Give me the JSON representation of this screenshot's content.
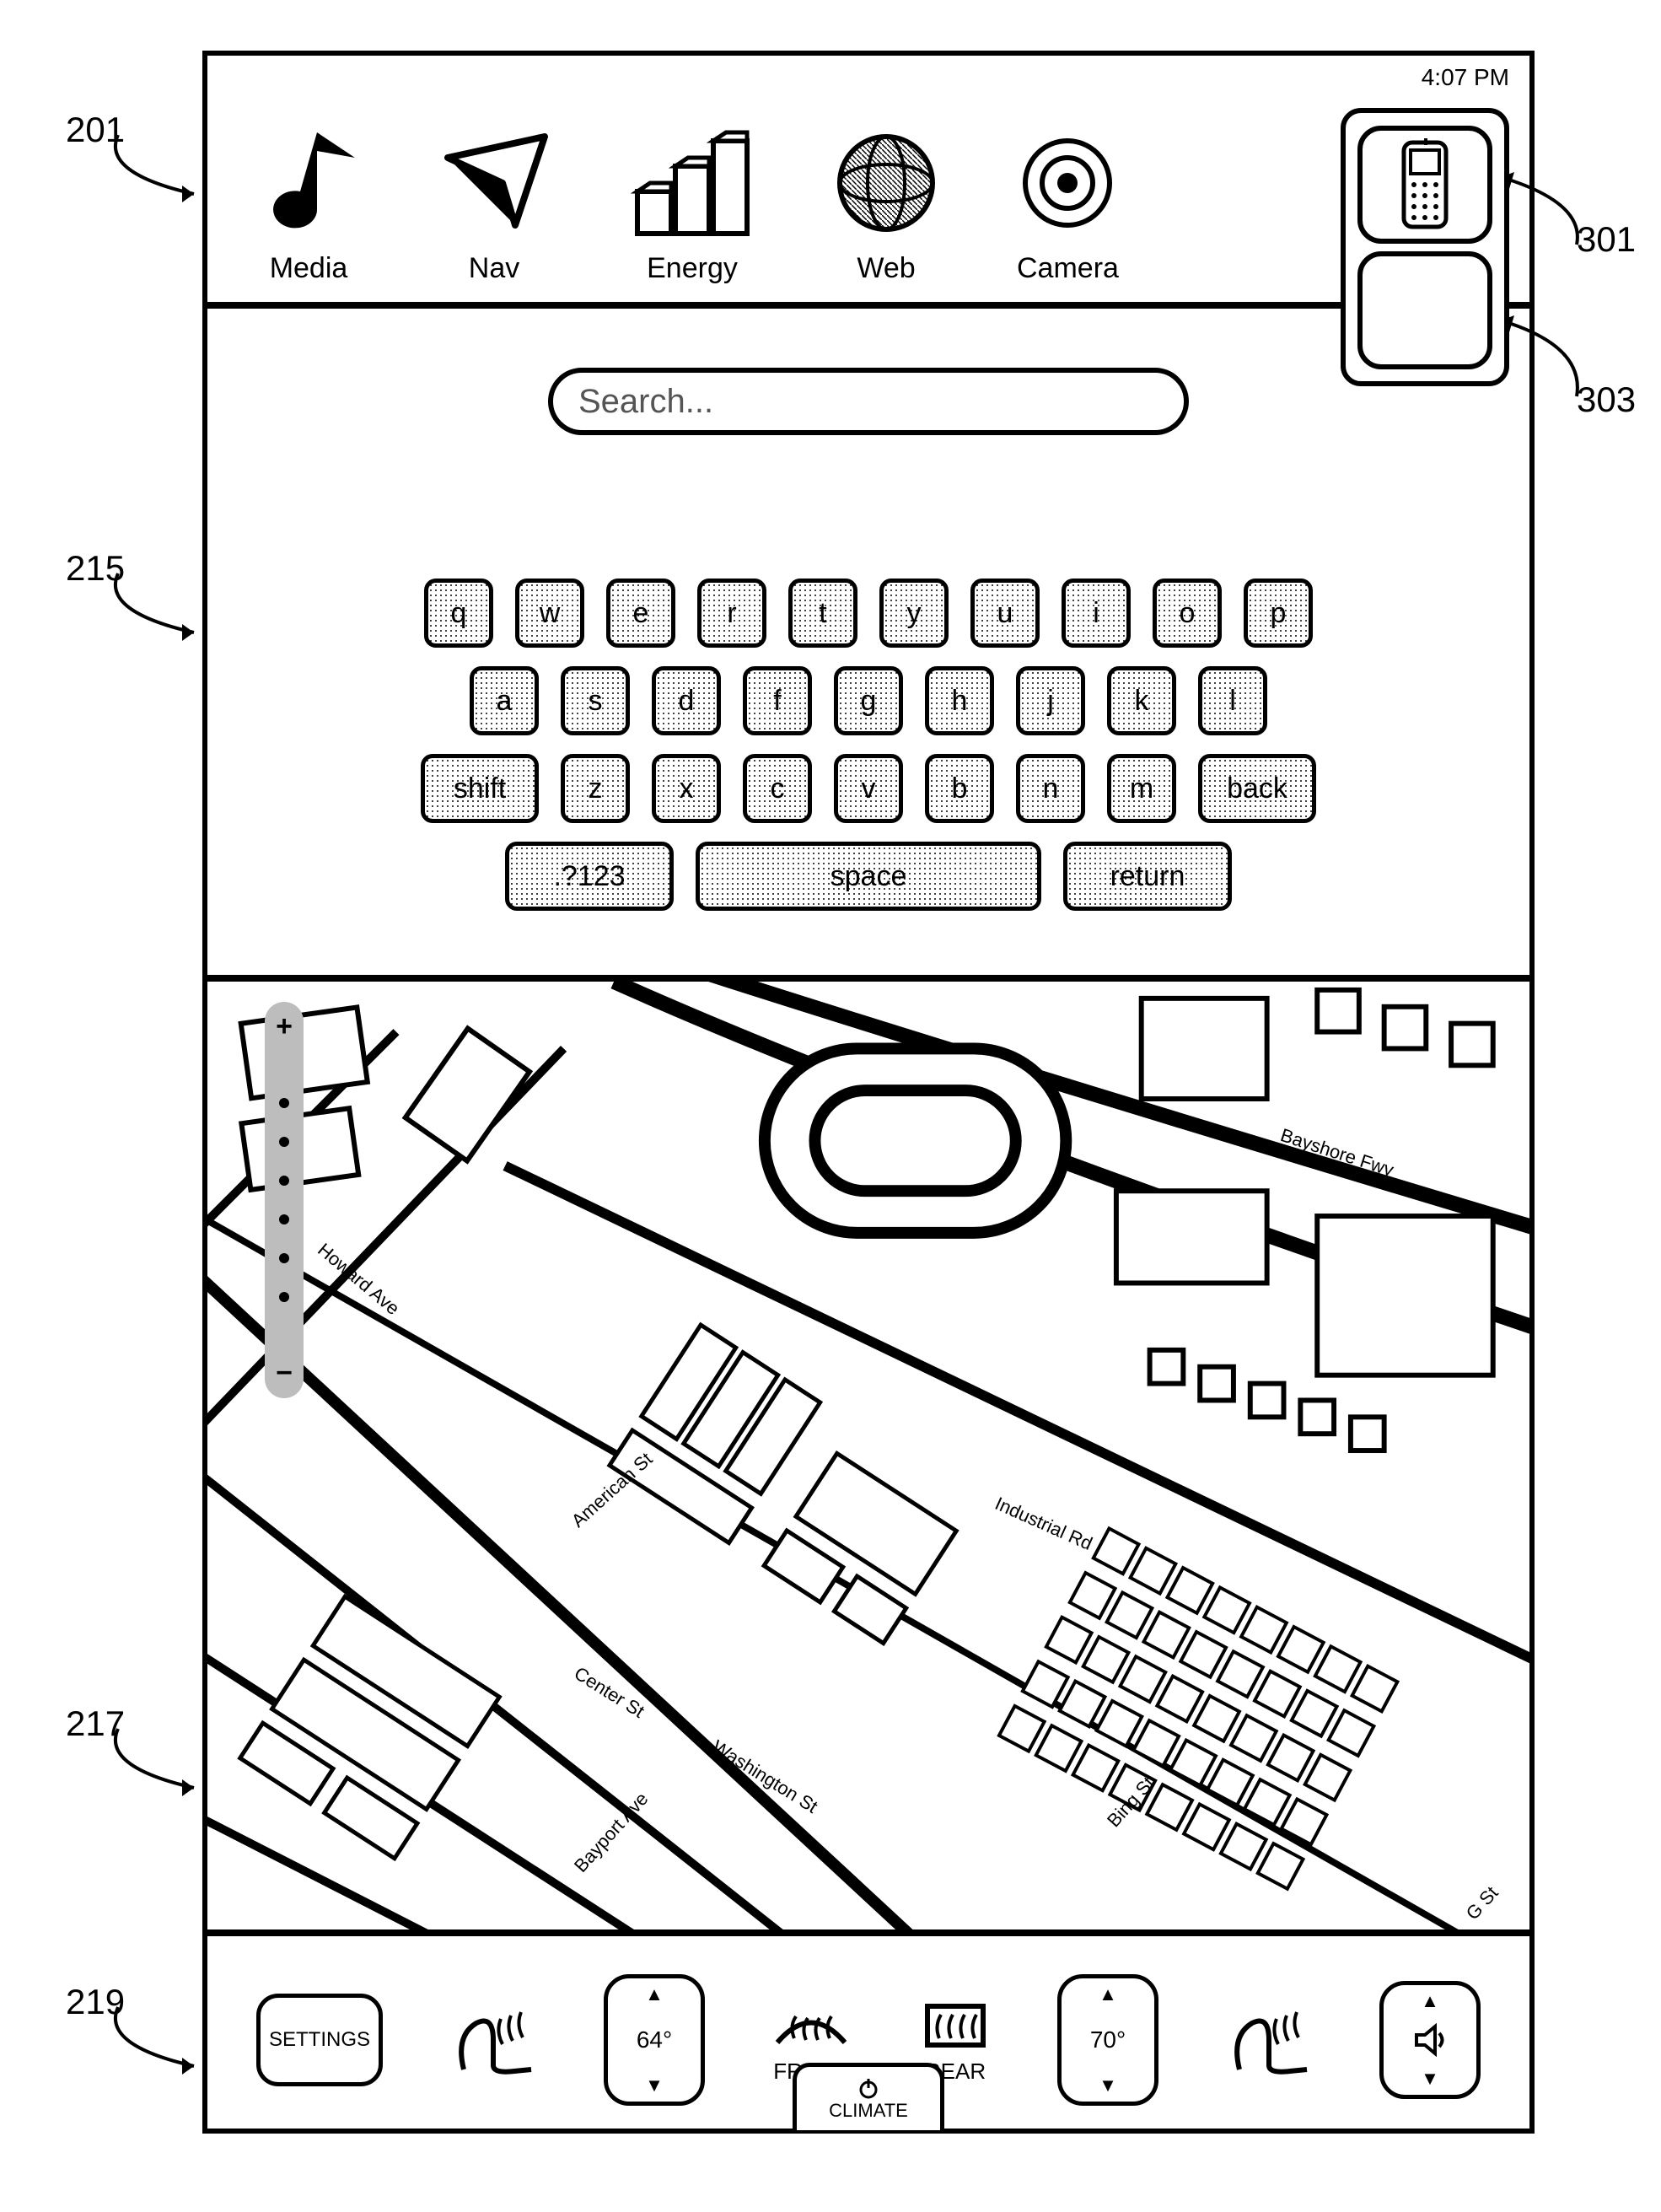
{
  "callouts": {
    "c201": "201",
    "c215": "215",
    "c217": "217",
    "c219": "219",
    "c301": "301",
    "c303": "303"
  },
  "status": {
    "time": "4:07 PM"
  },
  "apps": {
    "media": "Media",
    "nav": "Nav",
    "energy": "Energy",
    "web": "Web",
    "camera": "Camera"
  },
  "search": {
    "placeholder": "Search..."
  },
  "keyboard": {
    "r1": {
      "k0": "q",
      "k1": "w",
      "k2": "e",
      "k3": "r",
      "k4": "t",
      "k5": "y",
      "k6": "u",
      "k7": "i",
      "k8": "o",
      "k9": "p"
    },
    "r2": {
      "k0": "a",
      "k1": "s",
      "k2": "d",
      "k3": "f",
      "k4": "g",
      "k5": "h",
      "k6": "j",
      "k7": "k",
      "k8": "l"
    },
    "r3": {
      "shift": "shift",
      "k0": "z",
      "k1": "x",
      "k2": "c",
      "k3": "v",
      "k4": "b",
      "k5": "n",
      "k6": "m",
      "back": "back"
    },
    "r4": {
      "sym": ".?123",
      "space": "space",
      "ret": "return"
    }
  },
  "map": {
    "zoom": {
      "plus": "+",
      "minus": "−"
    },
    "streets": {
      "howard": "Howard Ave",
      "american": "American St",
      "center": "Center St",
      "bayport": "Bayport Ave",
      "washington": "Washington St",
      "industrial": "Industrial Rd",
      "bing": "Bing St",
      "g": "G St",
      "bayshore": "Bayshore Fwy"
    }
  },
  "bottom": {
    "settings": "SETTINGS",
    "temp_left": "64°",
    "front": "FRONT",
    "rear": "REAR",
    "temp_right": "70°",
    "climate": "CLIMATE"
  }
}
